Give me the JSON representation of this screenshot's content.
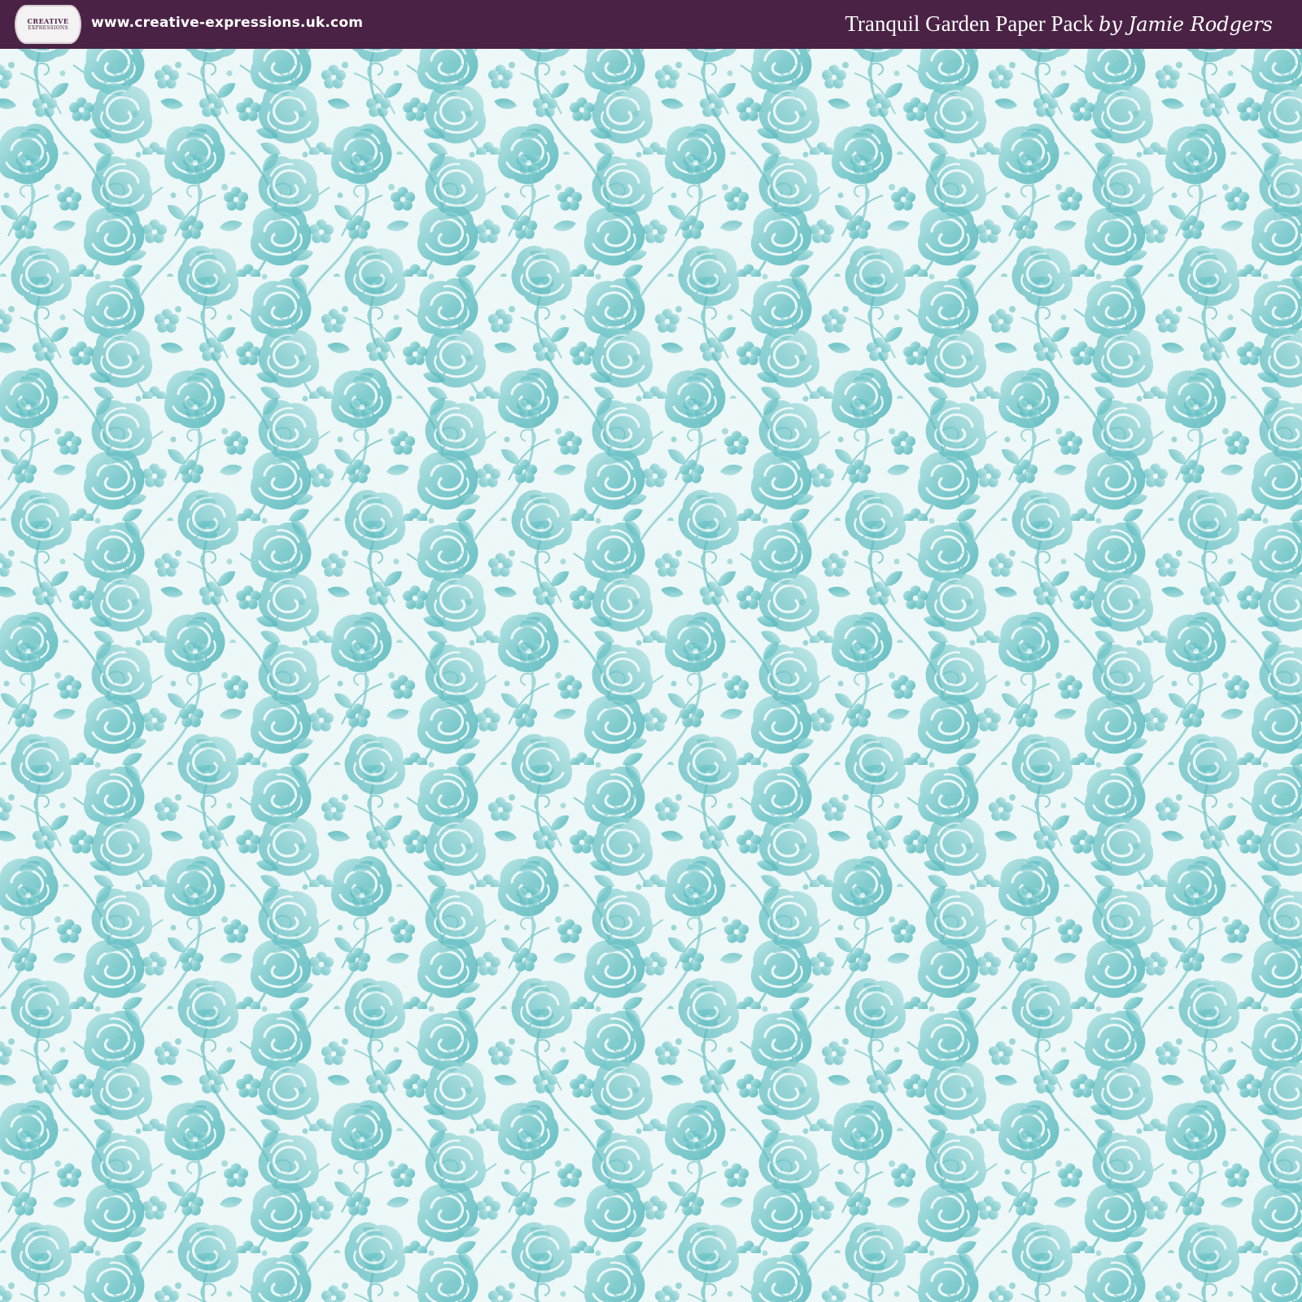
{
  "header": {
    "logo": {
      "line1": "CREATIVE",
      "line2": "EXPRESSIONS"
    },
    "website": "www.creative-expressions.uk.com",
    "pack_title": "Tranquil Garden Paper Pack",
    "byline": "by Jamie Rodgers"
  },
  "colors": {
    "header_bg": "#4a2245",
    "paper_bg": "#eef8f8",
    "pattern_teal": "#6cc3c6"
  },
  "pattern": {
    "motifs": [
      "rose",
      "five-petal-flower",
      "leaf",
      "swirl-stem",
      "dot"
    ],
    "layout": "vertical floral vine stripes"
  }
}
